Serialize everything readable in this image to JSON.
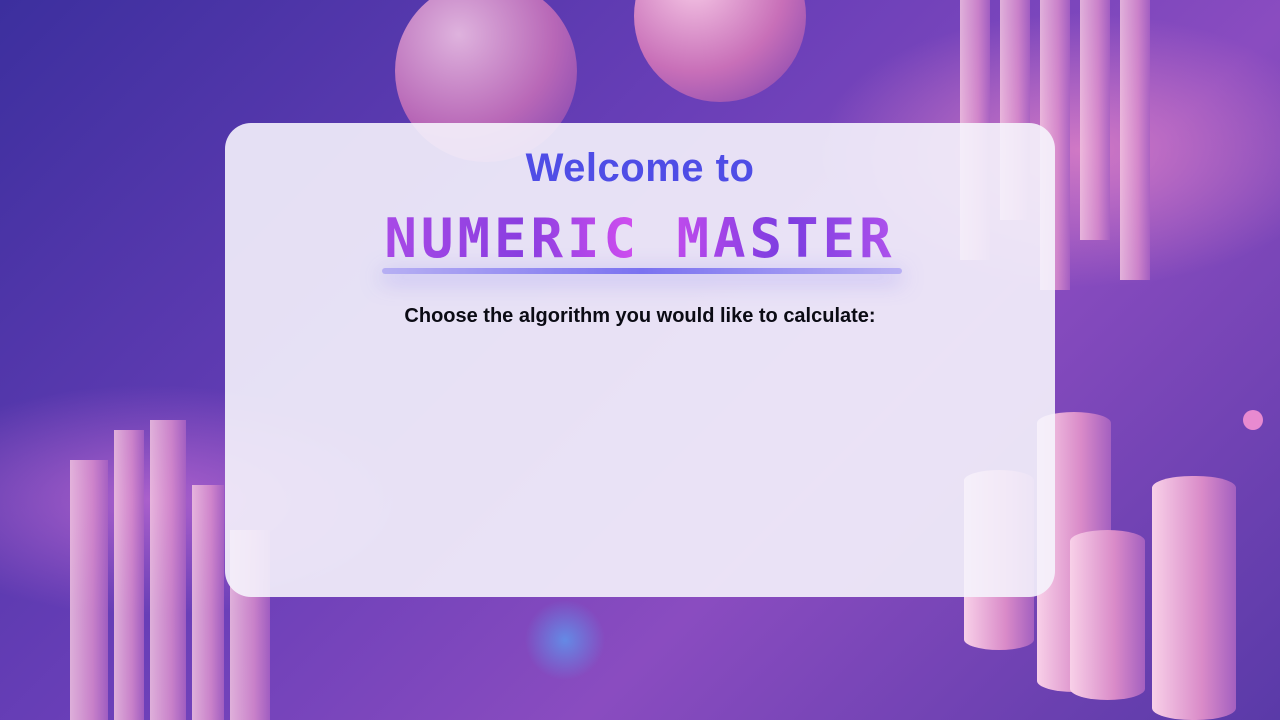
{
  "header": {
    "title": "Welcome to",
    "logo_text": "NUMERIC MASTER"
  },
  "main": {
    "prompt": "Choose the algorithm you would like to calculate:"
  },
  "colors": {
    "title": "#4f4de6",
    "logo": "#8a3ee0",
    "prompt": "#0b0b14",
    "panel": "#f5f3fc"
  }
}
